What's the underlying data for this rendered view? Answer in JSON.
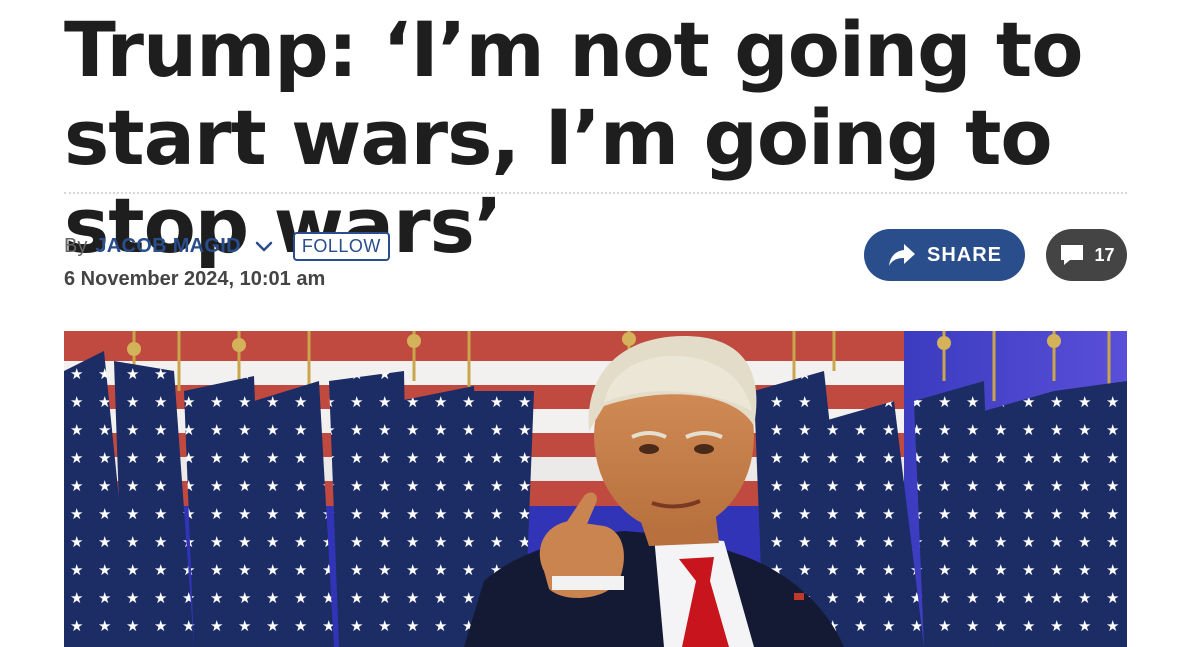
{
  "article": {
    "headline": "Trump: ‘I’m not going to start wars, I’m going to stop wars’",
    "byline_prefix": "By",
    "author": "JACOB MAGID",
    "follow_label": "FOLLOW",
    "date": "6 November 2024, 10:01 am"
  },
  "actions": {
    "share_label": "SHARE",
    "comment_count": "17"
  },
  "colors": {
    "brand_blue": "#2a4d8c",
    "comment_gray": "#444444"
  },
  "icons": {
    "author_menu": "chevron-down-icon",
    "share": "share-arrow-icon",
    "comments": "comment-bubble-icon"
  }
}
